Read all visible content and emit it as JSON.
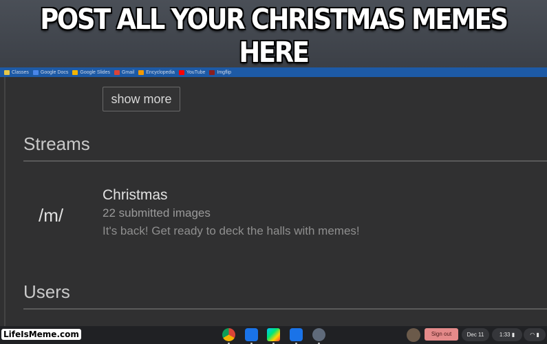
{
  "meme": {
    "caption": "POST ALL YOUR CHRISTMAS MEMES HERE",
    "watermark": "LifeIsMeme.com"
  },
  "bookmarks": [
    {
      "label": "Classes",
      "color": "#e6c64a"
    },
    {
      "label": "Google Docs",
      "color": "#4a86e8"
    },
    {
      "label": "Google Slides",
      "color": "#f4b400"
    },
    {
      "label": "Gmail",
      "color": "#db4437"
    },
    {
      "label": "Encyclopedia",
      "color": "#f29900"
    },
    {
      "label": "YouTube",
      "color": "#ff0000"
    },
    {
      "label": "Imgflip",
      "color": "#333333"
    }
  ],
  "main": {
    "show_more": "show more",
    "streams_heading": "Streams",
    "stream": {
      "icon_text": "/m/",
      "name": "Christmas",
      "count": "22 submitted images",
      "description": "It's back! Get ready to deck the halls with memes!"
    },
    "users_heading": "Users"
  },
  "shelf": {
    "sign_out": "Sign out",
    "date": "Dec 11",
    "time": "1:33",
    "apps": [
      "chrome-icon",
      "files-icon",
      "play-store-icon",
      "camera-icon",
      "settings-app-icon"
    ]
  }
}
